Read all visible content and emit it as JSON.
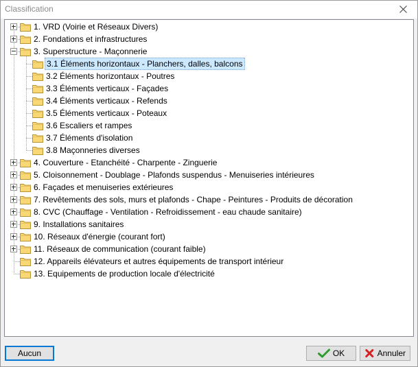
{
  "window": {
    "title": "Classification"
  },
  "tree": [
    {
      "label": "1. VRD (Voirie et Réseaux Divers)",
      "level": 0,
      "toggle": "plus"
    },
    {
      "label": "2. Fondations et infrastructures",
      "level": 0,
      "toggle": "plus"
    },
    {
      "label": "3. Superstructure - Maçonnerie",
      "level": 0,
      "toggle": "minus"
    },
    {
      "label": "3.1 Éléments horizontaux - Planchers, dalles, balcons",
      "level": 1,
      "toggle": "none",
      "selected": true
    },
    {
      "label": "3.2 Éléments horizontaux - Poutres",
      "level": 1,
      "toggle": "none"
    },
    {
      "label": "3.3 Éléments verticaux - Façades",
      "level": 1,
      "toggle": "none"
    },
    {
      "label": "3.4 Éléments verticaux - Refends",
      "level": 1,
      "toggle": "none"
    },
    {
      "label": "3.5 Éléments verticaux - Poteaux",
      "level": 1,
      "toggle": "none"
    },
    {
      "label": "3.6 Escaliers et rampes",
      "level": 1,
      "toggle": "none"
    },
    {
      "label": "3.7 Éléments d'isolation",
      "level": 1,
      "toggle": "none"
    },
    {
      "label": "3.8 Maçonneries diverses",
      "level": 1,
      "toggle": "none"
    },
    {
      "label": "4. Couverture - Etanchéité - Charpente - Zinguerie",
      "level": 0,
      "toggle": "plus"
    },
    {
      "label": "5. Cloisonnement - Doublage - Plafonds suspendus - Menuiseries intérieures",
      "level": 0,
      "toggle": "plus"
    },
    {
      "label": "6. Façades et menuiseries extérieures",
      "level": 0,
      "toggle": "plus"
    },
    {
      "label": "7. Revêtements des sols, murs et plafonds - Chape - Peintures - Produits de décoration",
      "level": 0,
      "toggle": "plus"
    },
    {
      "label": "8. CVC (Chauffage - Ventilation - Refroidissement - eau chaude sanitaire)",
      "level": 0,
      "toggle": "plus"
    },
    {
      "label": "9. Installations sanitaires",
      "level": 0,
      "toggle": "plus"
    },
    {
      "label": "10. Réseaux d'énergie (courant fort)",
      "level": 0,
      "toggle": "plus"
    },
    {
      "label": "11. Réseaux de communication (courant faible)",
      "level": 0,
      "toggle": "plus"
    },
    {
      "label": "12. Appareils élévateurs et autres équipements de transport intérieur",
      "level": 0,
      "toggle": "none"
    },
    {
      "label": "13. Equipements de production locale d'électricité",
      "level": 0,
      "toggle": "none"
    }
  ],
  "buttons": {
    "none_label": "Aucun",
    "ok_label": "OK",
    "cancel_label": "Annuler"
  },
  "colors": {
    "selection": "#cce8ff",
    "default_button_border": "#0078d7",
    "folder": "#f8d775"
  },
  "icons": {
    "close": "close-icon",
    "folder": "folder-icon",
    "ok": "checkmark-icon",
    "cancel": "red-x-icon"
  }
}
